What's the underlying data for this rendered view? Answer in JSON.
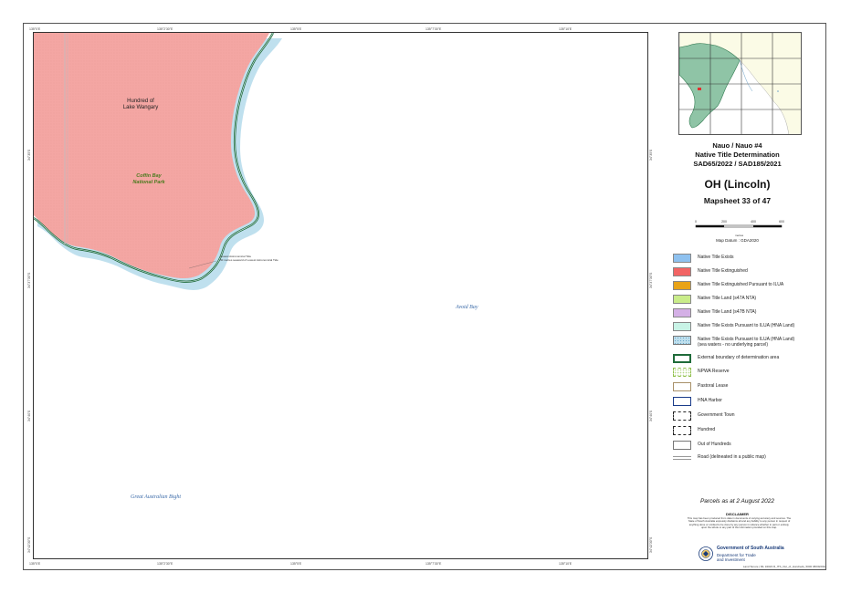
{
  "map": {
    "hundred_label": "Hundred of\nLake Wangary",
    "park_label": "Coffin Bay\nNational Park",
    "water_labels": {
      "avoid_bay": "Avoid Bay",
      "bight": "Great Australian Bight"
    },
    "annotation": "Lowest Astronomical Tide\n50 metres seaward of Lowest Astronomical Tide",
    "ticks_top": [
      "135°0'E",
      "135°2'30\"E",
      "135°5'E",
      "135°7'30\"E",
      "135°10'E"
    ],
    "ticks_side": [
      "34°35'S",
      "34°37'30\"S",
      "34°40'S",
      "34°42'30\"S"
    ],
    "colors": {
      "land_parcel": "#f4a6a3",
      "sea_strip": "#bfe0ee",
      "boundary": "#1f6b3a"
    }
  },
  "panel": {
    "title_line1": "Nauo / Nauo #4",
    "title_line2": "Native Title Determination",
    "title_line3": "SAD65/2022 / SAD185/2021",
    "map_name": "OH (Lincoln)",
    "mapsheet": "Mapsheet 33 of 47",
    "scale_ticks": [
      "0",
      "200",
      "400",
      "600"
    ],
    "scale_unit": "metres",
    "datum": "Map Datum : GDA2020",
    "parcels_date": "Parcels as at 2 August 2022",
    "disclaimer_title": "DISCLAIMER",
    "disclaimer_text": "This map has been produced from data in documents of varying accuracy and sources. The State of South Australia expressly disclaims all and any liability to any person in respect of anything done or omitted to be done by any person in reliance whether in part or entirely, upon the whole or any part of the information provided on this map.",
    "gov_name": "Government of South Australia",
    "gov_dept": "Department for Trade\nand Investment",
    "footer": "Land Tenure | ML 32023 R_ITS_Out_of_Hundreds_5000 08/09/2022"
  },
  "legend": [
    {
      "label": "Native Title Exists",
      "color": "#8ec1ef",
      "style": "fill"
    },
    {
      "label": "Native Title Extinguished",
      "color": "#f26464",
      "style": "fill"
    },
    {
      "label": "Native Title Extinguished Pursuant to ILUA",
      "color": "#e8a317",
      "style": "fill"
    },
    {
      "label": "Native Title Land (s47A NTA)",
      "color": "#c9ec8a",
      "style": "fill"
    },
    {
      "label": "Native Title Land (s47B NTA)",
      "color": "#d4b0e6",
      "style": "fill"
    },
    {
      "label": "Native Title Exists Pursuant to ILUA (HNA Land)",
      "color": "#c8f3e6",
      "style": "fill"
    },
    {
      "label": "Native Title Exists Pursuant to ILUA (HNA Land)\n(sea waters - no underlying parcel)",
      "color": "#bfe0ee",
      "style": "dots"
    },
    {
      "label": "External boundary of determination area",
      "color": "#1f6b3a",
      "style": "thick"
    },
    {
      "label": "NPWA Reserve",
      "color": "#8fbf4a",
      "style": "dashed-green"
    },
    {
      "label": "Pastoral Lease",
      "color": "#a89068",
      "style": "outline"
    },
    {
      "label": "HNA Harbor",
      "color": "#1a3c8a",
      "style": "outline-blue"
    },
    {
      "label": "Government Town",
      "color": "#222222",
      "style": "dashed-dark"
    },
    {
      "label": "Hundred",
      "color": "#222222",
      "style": "dashed-light"
    },
    {
      "label": "Out of Hundreds",
      "color": "#777777",
      "style": "outline"
    },
    {
      "label": "Road (delineated in a public map)",
      "color": "#999999",
      "style": "road"
    }
  ]
}
